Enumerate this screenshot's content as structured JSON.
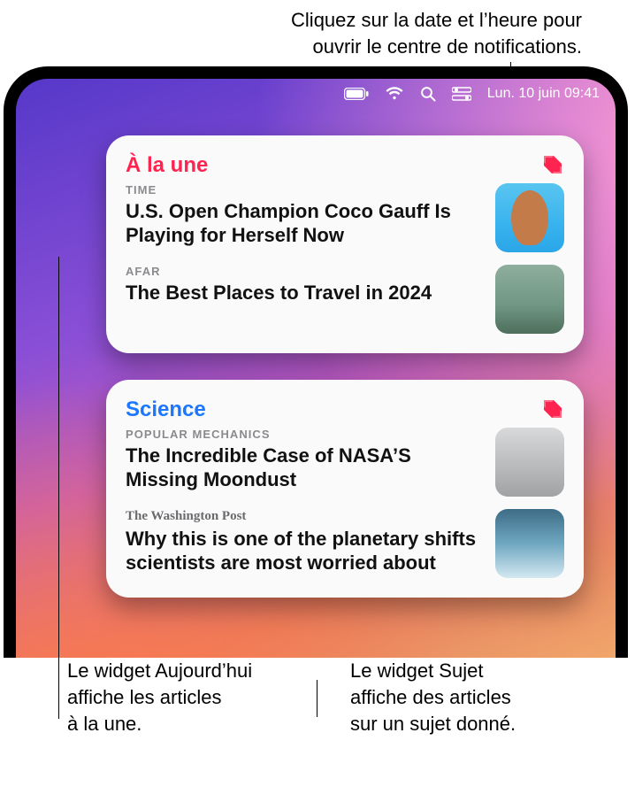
{
  "top_callout_line1": "Cliquez sur la date et l’heure pour",
  "top_callout_line2": "ouvrir le centre de notifications.",
  "menubar": {
    "clock": "Lun. 10 juin  09:41"
  },
  "widgets": [
    {
      "title": "À la une",
      "articles": [
        {
          "source": "TIME",
          "headline": "U.S. Open Champion Coco Gauff Is Playing for Herself Now"
        },
        {
          "source": "AFAR",
          "headline": "The Best Places to Travel in 2024"
        }
      ]
    },
    {
      "title": "Science",
      "articles": [
        {
          "source": "POPULAR MECHANICS",
          "headline": "The Incredible Case of NASA’S Missing Moondust"
        },
        {
          "source": "The Washington Post",
          "headline": "Why this is one of the planetary shifts scientists are most worried about"
        }
      ]
    }
  ],
  "bottom_callouts": {
    "left_l1": "Le widget Aujourd’hui",
    "left_l2": "affiche les articles",
    "left_l3": "à la une.",
    "right_l1": "Le widget Sujet",
    "right_l2": "affiche des articles",
    "right_l3": "sur un sujet donné."
  }
}
